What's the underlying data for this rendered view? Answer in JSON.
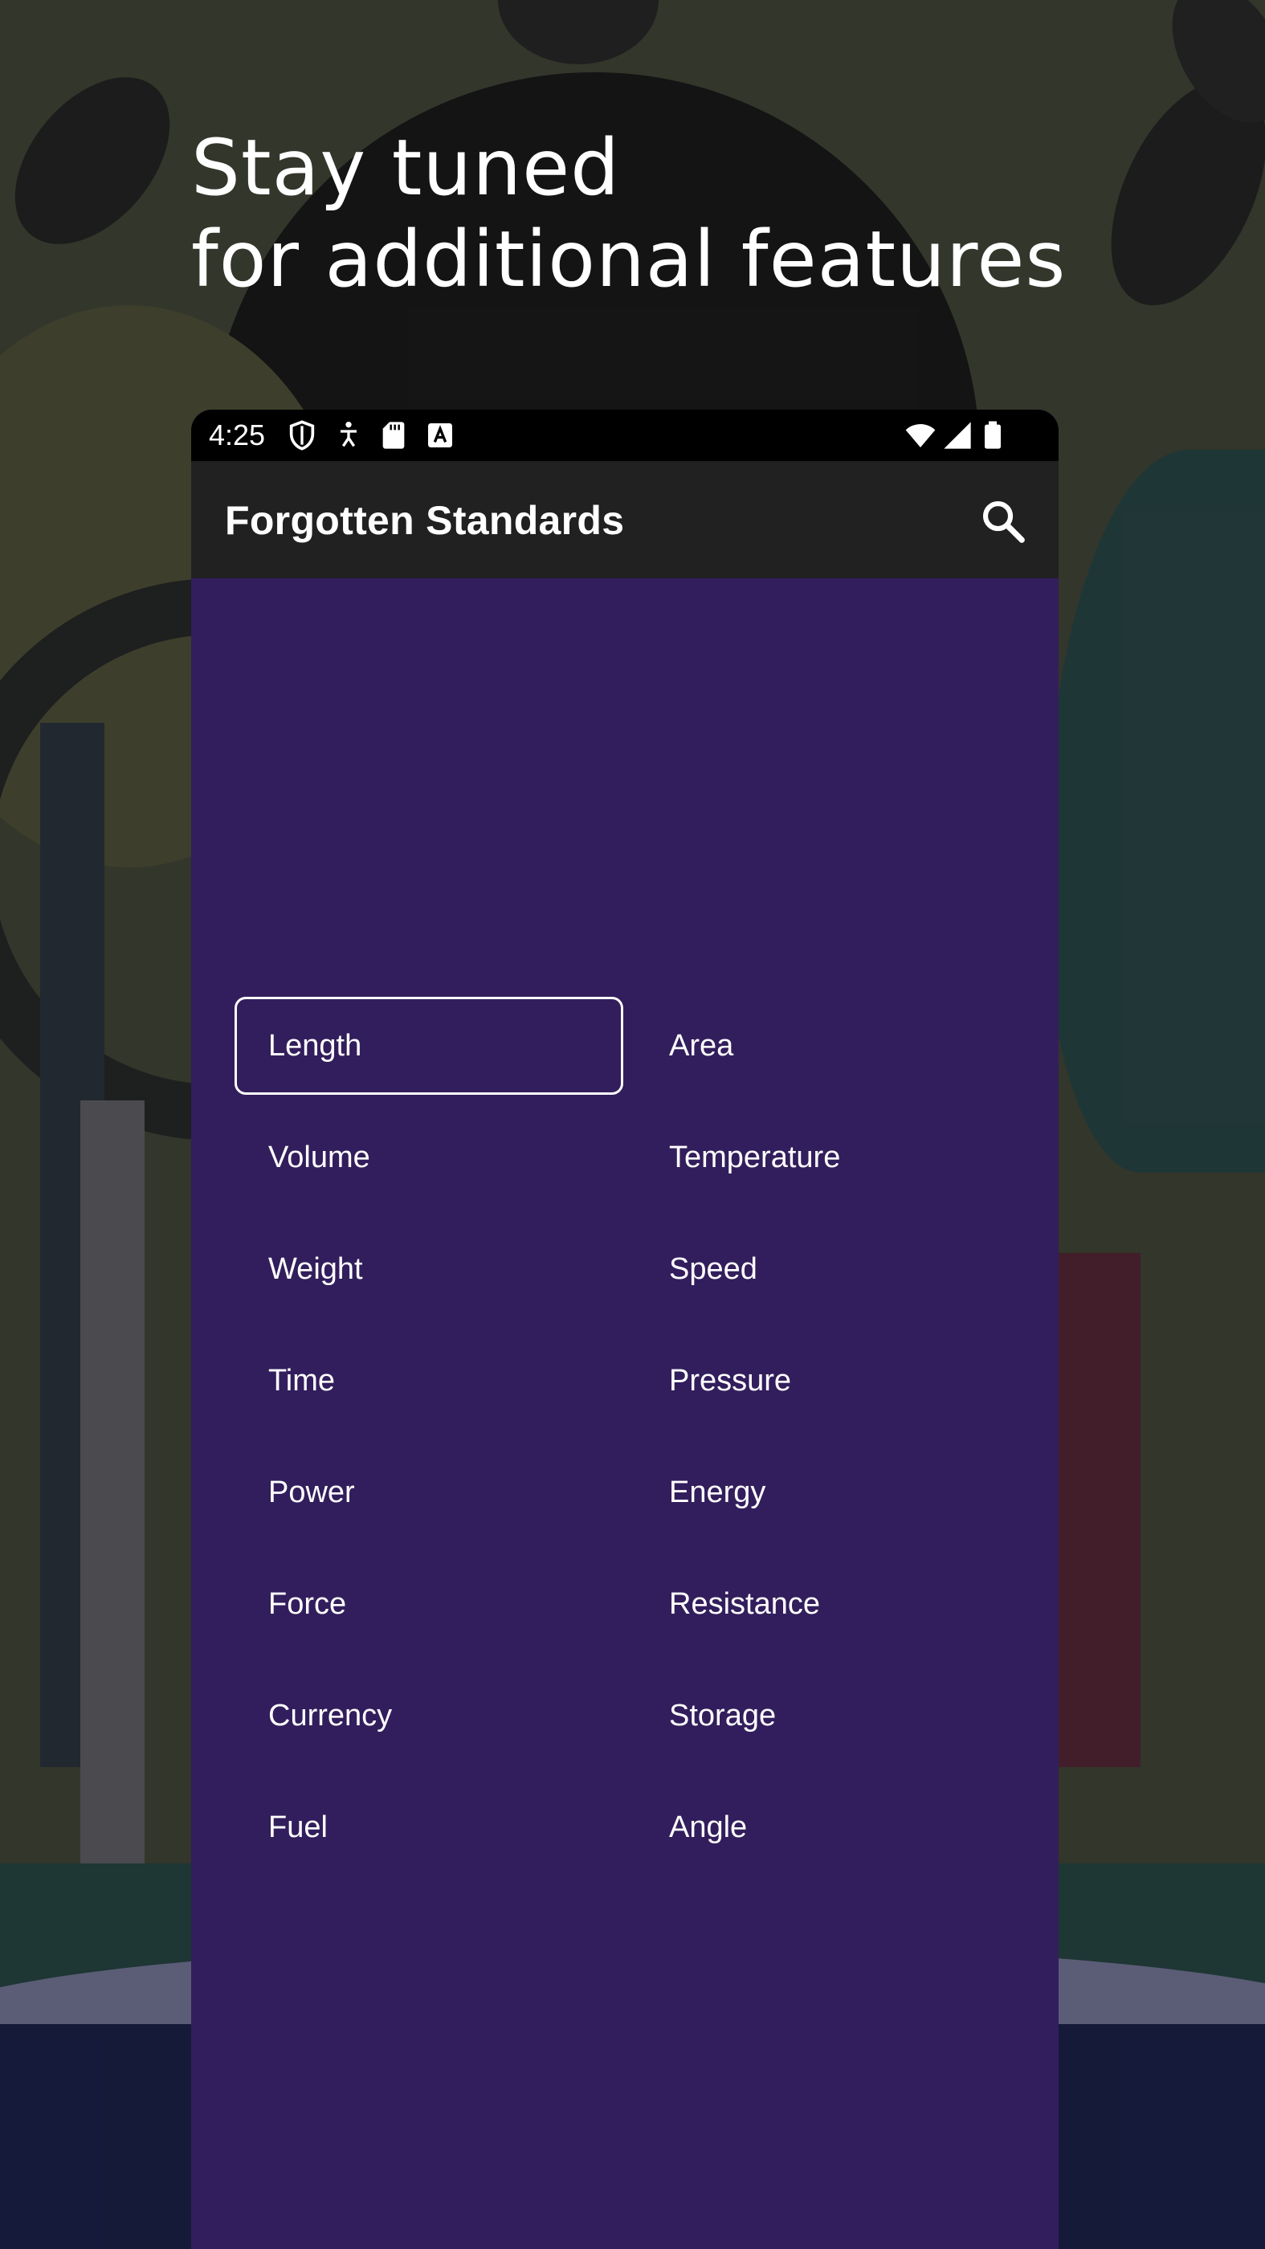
{
  "headline": {
    "line1": "Stay tuned",
    "line2": "for additional features"
  },
  "status_bar": {
    "time": "4:25",
    "left_icons": [
      "shield-icon",
      "accessibility-icon",
      "sd-card-icon",
      "a-badge-icon"
    ],
    "right_icons": [
      "wifi-icon",
      "signal-icon",
      "battery-icon"
    ]
  },
  "app_bar": {
    "title": "Forgotten Standards",
    "search_icon": "search-icon"
  },
  "categories": [
    {
      "label": "Length",
      "selected": true
    },
    {
      "label": "Area"
    },
    {
      "label": "Volume"
    },
    {
      "label": "Temperature"
    },
    {
      "label": "Weight"
    },
    {
      "label": "Speed"
    },
    {
      "label": "Time"
    },
    {
      "label": "Pressure"
    },
    {
      "label": "Power"
    },
    {
      "label": "Energy"
    },
    {
      "label": "Force"
    },
    {
      "label": "Resistance"
    },
    {
      "label": "Currency"
    },
    {
      "label": "Storage"
    },
    {
      "label": "Fuel"
    },
    {
      "label": "Angle"
    }
  ],
  "colors": {
    "panel": "#321e5c",
    "app_bar": "#212121",
    "status_bar": "#000000",
    "text": "#ffffff"
  }
}
